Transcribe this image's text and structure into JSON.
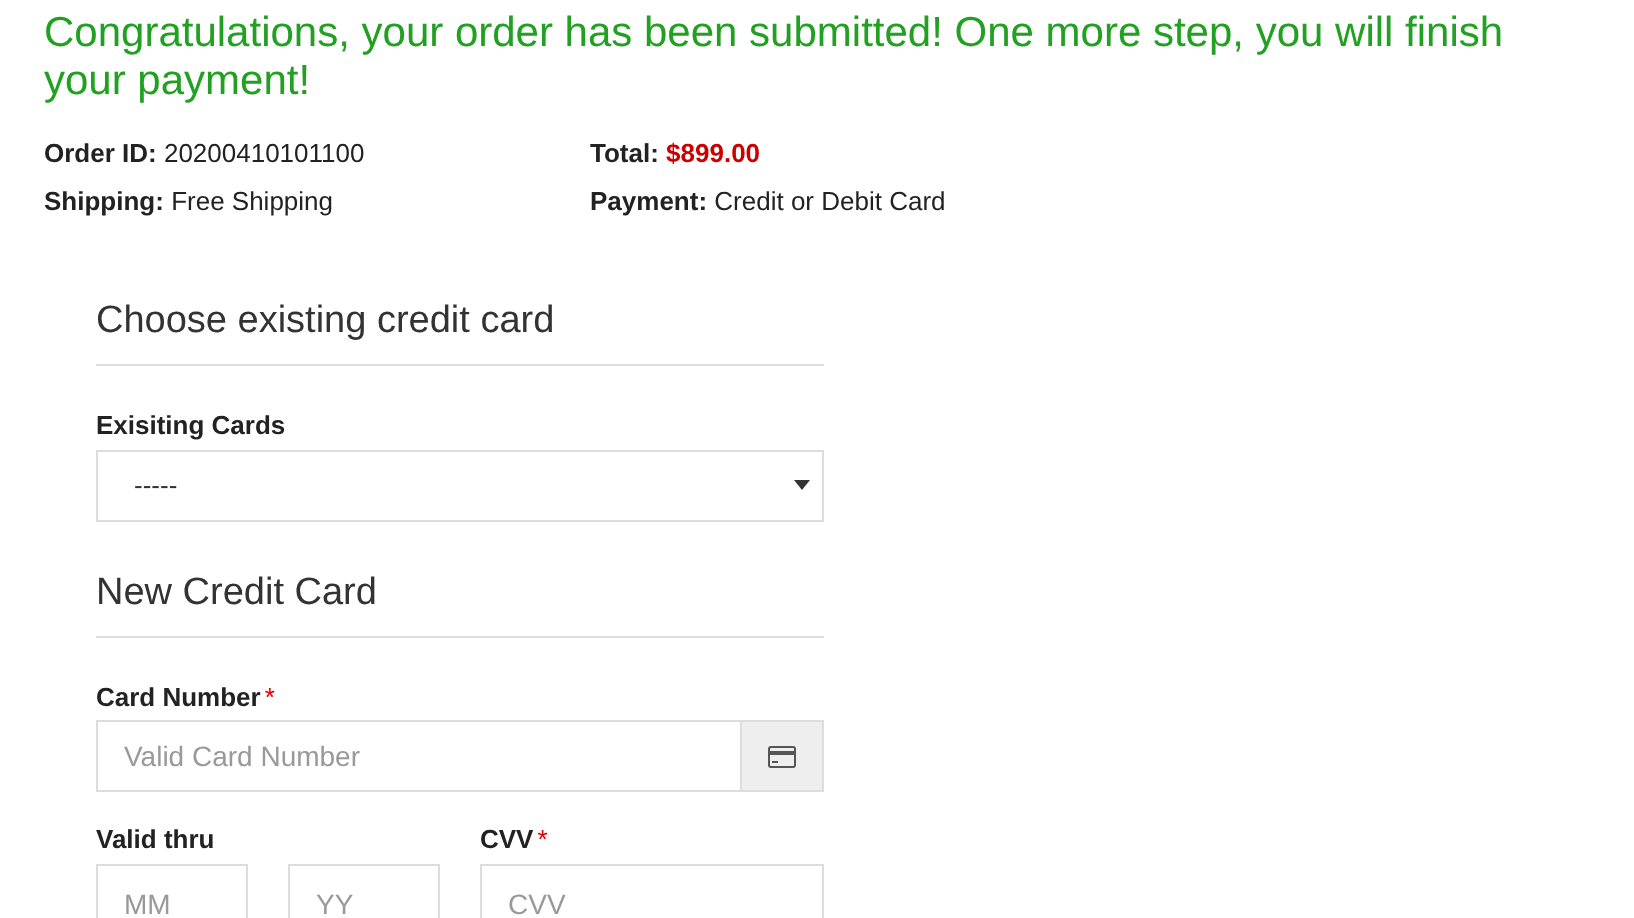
{
  "heading": "Congratulations, your order has been submitted! One more step, you will finish your payment!",
  "summary": [
    {
      "label": "Order ID:",
      "value": "20200410101100",
      "kind": "plain"
    },
    {
      "label": "Total:",
      "value": "$899.00",
      "kind": "price"
    },
    {
      "label": "Shipping:",
      "value": "Free Shipping",
      "kind": "plain"
    },
    {
      "label": "Payment:",
      "value": "Credit or Debit Card",
      "kind": "plain"
    }
  ],
  "existing": {
    "title": "Choose existing credit card",
    "label": "Exisiting Cards",
    "value": "-----"
  },
  "new_card": {
    "title": "New Credit Card",
    "card_number": {
      "label": "Card Number",
      "required_mark": "*",
      "placeholder": "Valid Card Number"
    },
    "valid_thru": {
      "label": "Valid thru",
      "month_placeholder": "MM",
      "year_placeholder": "YY"
    },
    "cvv": {
      "label": "CVV",
      "required_mark": "*",
      "placeholder": "CVV"
    }
  }
}
